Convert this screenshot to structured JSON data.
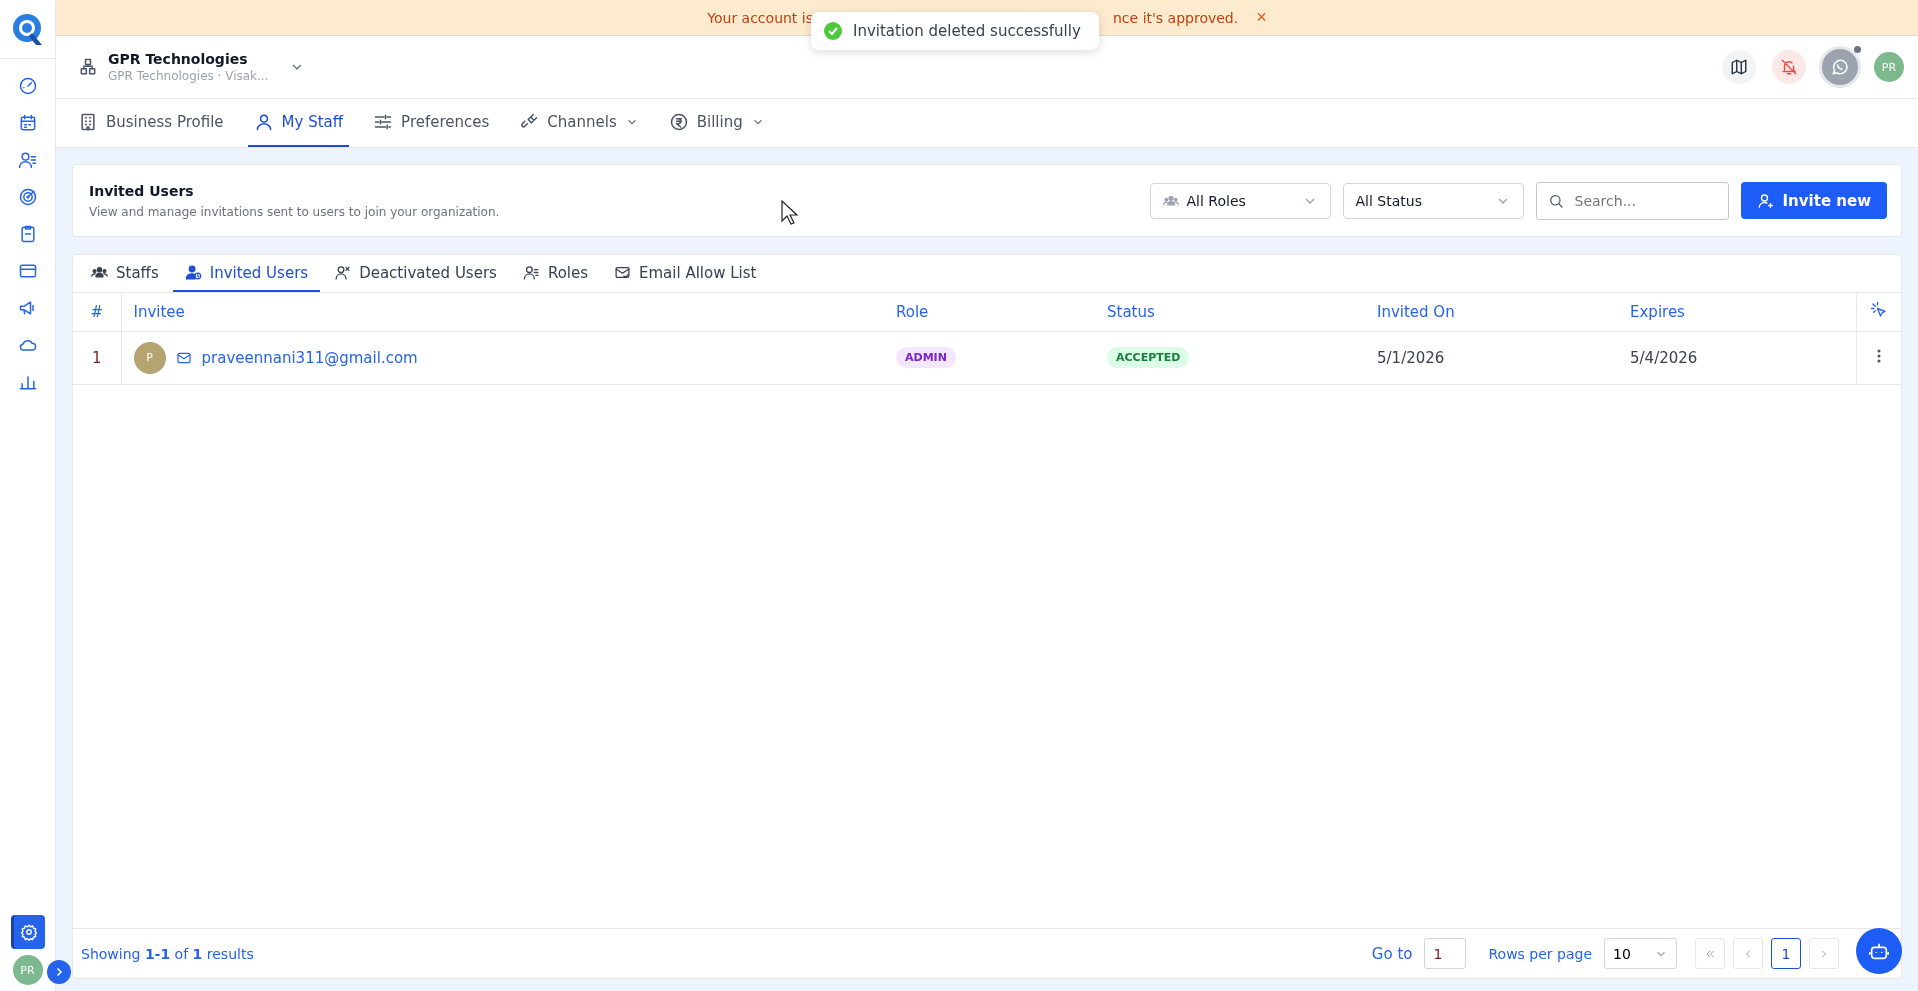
{
  "banner": {
    "text_start": "Your account is",
    "text_end": "nce it's approved.",
    "close": "×"
  },
  "toast": {
    "message": "Invitation deleted successfully"
  },
  "organization": {
    "name": "GPR Technologies",
    "subtitle": "GPR Technologies · Visak..."
  },
  "header": {
    "avatar": "PR",
    "whatsapp_status_dot": true
  },
  "nav_tabs": [
    {
      "label": "Business Profile",
      "selected": false,
      "dropdown": false
    },
    {
      "label": "My Staff",
      "selected": true,
      "dropdown": false
    },
    {
      "label": "Preferences",
      "selected": false,
      "dropdown": false
    },
    {
      "label": "Channels",
      "selected": false,
      "dropdown": true
    },
    {
      "label": "Billing",
      "selected": false,
      "dropdown": true
    }
  ],
  "sidebar": {
    "settings_selected": true,
    "avatar": "PR"
  },
  "section": {
    "title": "Invited Users",
    "description": "View and manage invitations sent to users to join your organization."
  },
  "filters": {
    "roles": "All Roles",
    "status": "All Status",
    "search_placeholder": "Search...",
    "invite_button": "Invite new"
  },
  "sub_tabs": [
    {
      "label": "Staffs",
      "selected": false
    },
    {
      "label": "Invited Users",
      "selected": true
    },
    {
      "label": "Deactivated Users",
      "selected": false
    },
    {
      "label": "Roles",
      "selected": false
    },
    {
      "label": "Email Allow List",
      "selected": false
    }
  ],
  "table": {
    "columns": [
      "#",
      "Invitee",
      "Role",
      "Status",
      "Invited On",
      "Expires"
    ],
    "rows": [
      {
        "index": "1",
        "avatar": "P",
        "email": "praveennani311@gmail.com",
        "role": "ADMIN",
        "status": "ACCEPTED",
        "invited_on": "5/1/2026",
        "expires": "5/4/2026"
      }
    ]
  },
  "footer": {
    "showing_prefix": "Showing ",
    "range": "1-1",
    "of": " of ",
    "total": "1",
    "suffix": " results",
    "go_to_label": "Go to",
    "go_to_value": "1",
    "rows_per_page_label": "Rows per page",
    "rows_per_page": "10",
    "current_page": "1"
  }
}
